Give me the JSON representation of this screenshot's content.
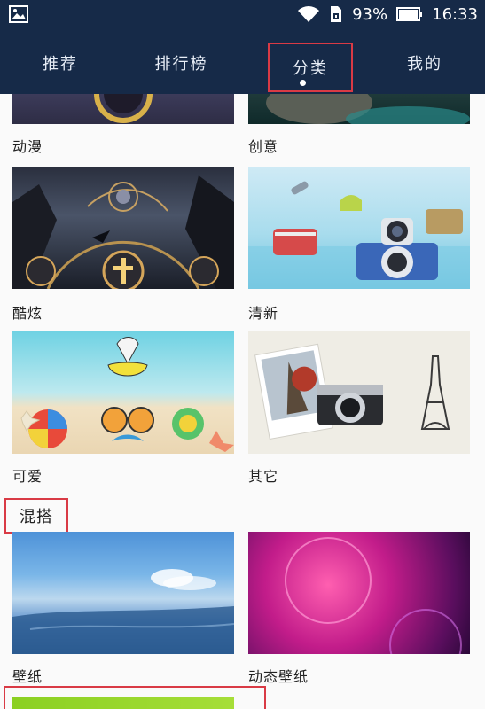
{
  "status_bar": {
    "battery": "93%",
    "time": "16:33"
  },
  "tabs": [
    {
      "label": "推荐"
    },
    {
      "label": "排行榜"
    },
    {
      "label": "分类"
    },
    {
      "label": "我的"
    }
  ],
  "categories": [
    {
      "label": "动漫"
    },
    {
      "label": "创意"
    },
    {
      "label": "酷炫"
    },
    {
      "label": "清新"
    },
    {
      "label": "可爱"
    },
    {
      "label": "其它"
    }
  ],
  "section": {
    "title": "混搭",
    "items": [
      {
        "label": "壁纸"
      },
      {
        "label": "动态壁纸"
      }
    ]
  },
  "icons": {
    "picture": "picture-icon",
    "wifi": "wifi-icon",
    "sim": "sim-icon",
    "battery": "battery-icon"
  }
}
